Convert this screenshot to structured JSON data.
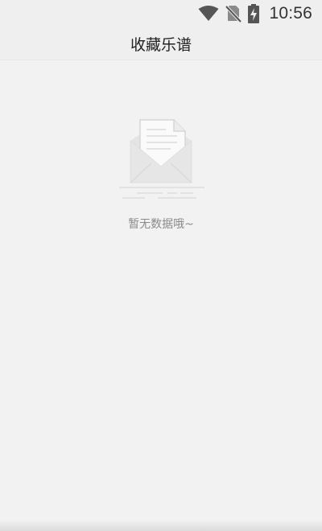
{
  "status_bar": {
    "time": "10:56",
    "icons": [
      "wifi-icon",
      "no-sim-icon",
      "battery-charging-icon"
    ]
  },
  "header": {
    "title": "收藏乐谱"
  },
  "empty_state": {
    "icon": "open-envelope-document-icon",
    "message": "暂无数据哦~"
  },
  "colors": {
    "background": "#f2f2f2",
    "header_background": "#efefef",
    "text_primary": "#222222",
    "text_muted": "#8a8a8a",
    "illustration": "#dcdcdc"
  }
}
